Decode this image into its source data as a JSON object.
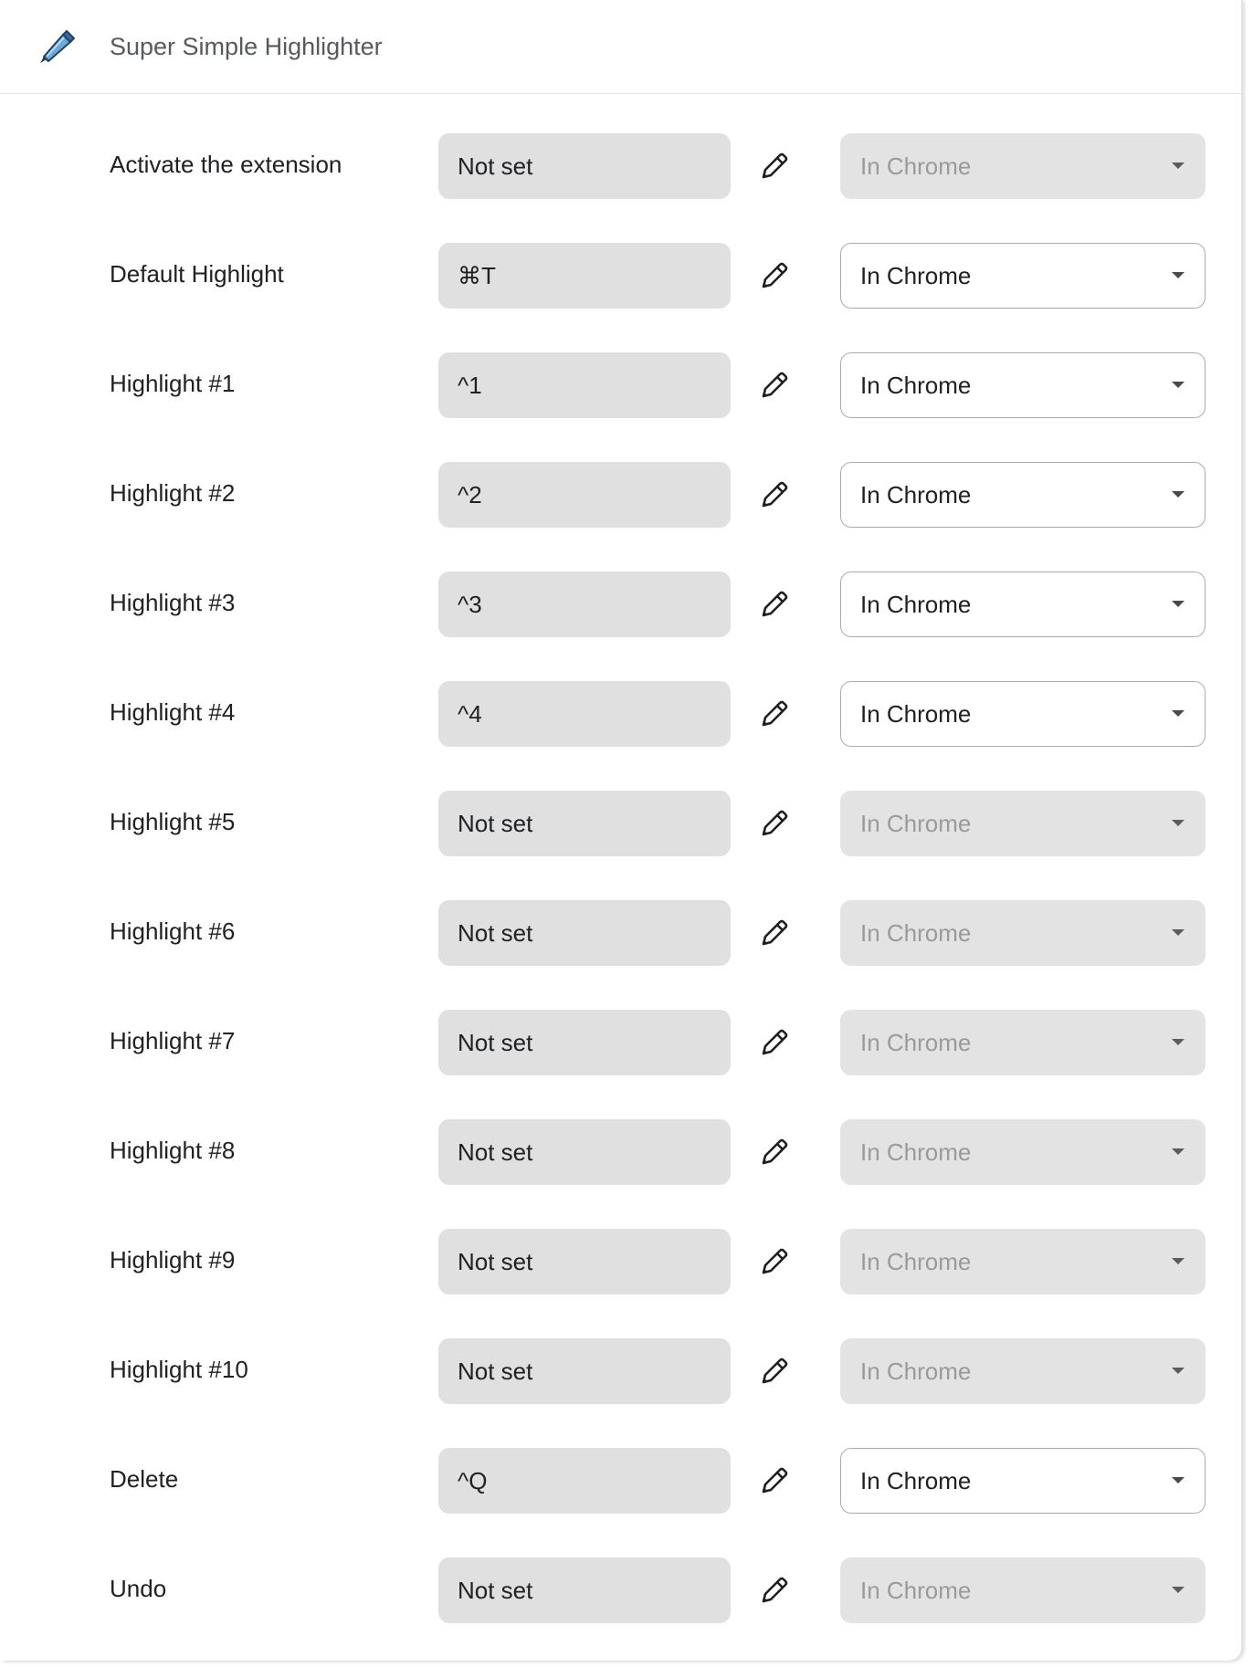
{
  "header": {
    "title": "Super Simple Highlighter",
    "icon": "highlighter-marker-icon"
  },
  "colors": {
    "field_bg": "#dfe0df",
    "disabled_text": "#9a9a9a",
    "text": "#202124"
  },
  "shortcuts": [
    {
      "label": "Activate the extension",
      "shortcut": "Not set",
      "scope": "In Chrome",
      "scope_enabled": false
    },
    {
      "label": "Default Highlight",
      "shortcut": "⌘T",
      "scope": "In Chrome",
      "scope_enabled": true
    },
    {
      "label": "Highlight #1",
      "shortcut": "^1",
      "scope": "In Chrome",
      "scope_enabled": true
    },
    {
      "label": "Highlight #2",
      "shortcut": "^2",
      "scope": "In Chrome",
      "scope_enabled": true
    },
    {
      "label": "Highlight #3",
      "shortcut": "^3",
      "scope": "In Chrome",
      "scope_enabled": true
    },
    {
      "label": "Highlight #4",
      "shortcut": "^4",
      "scope": "In Chrome",
      "scope_enabled": true
    },
    {
      "label": "Highlight #5",
      "shortcut": "Not set",
      "scope": "In Chrome",
      "scope_enabled": false
    },
    {
      "label": "Highlight #6",
      "shortcut": "Not set",
      "scope": "In Chrome",
      "scope_enabled": false
    },
    {
      "label": "Highlight #7",
      "shortcut": "Not set",
      "scope": "In Chrome",
      "scope_enabled": false
    },
    {
      "label": "Highlight #8",
      "shortcut": "Not set",
      "scope": "In Chrome",
      "scope_enabled": false
    },
    {
      "label": "Highlight #9",
      "shortcut": "Not set",
      "scope": "In Chrome",
      "scope_enabled": false
    },
    {
      "label": "Highlight #10",
      "shortcut": "Not set",
      "scope": "In Chrome",
      "scope_enabled": false
    },
    {
      "label": "Delete",
      "shortcut": "^Q",
      "scope": "In Chrome",
      "scope_enabled": true
    },
    {
      "label": "Undo",
      "shortcut": "Not set",
      "scope": "In Chrome",
      "scope_enabled": false
    }
  ]
}
